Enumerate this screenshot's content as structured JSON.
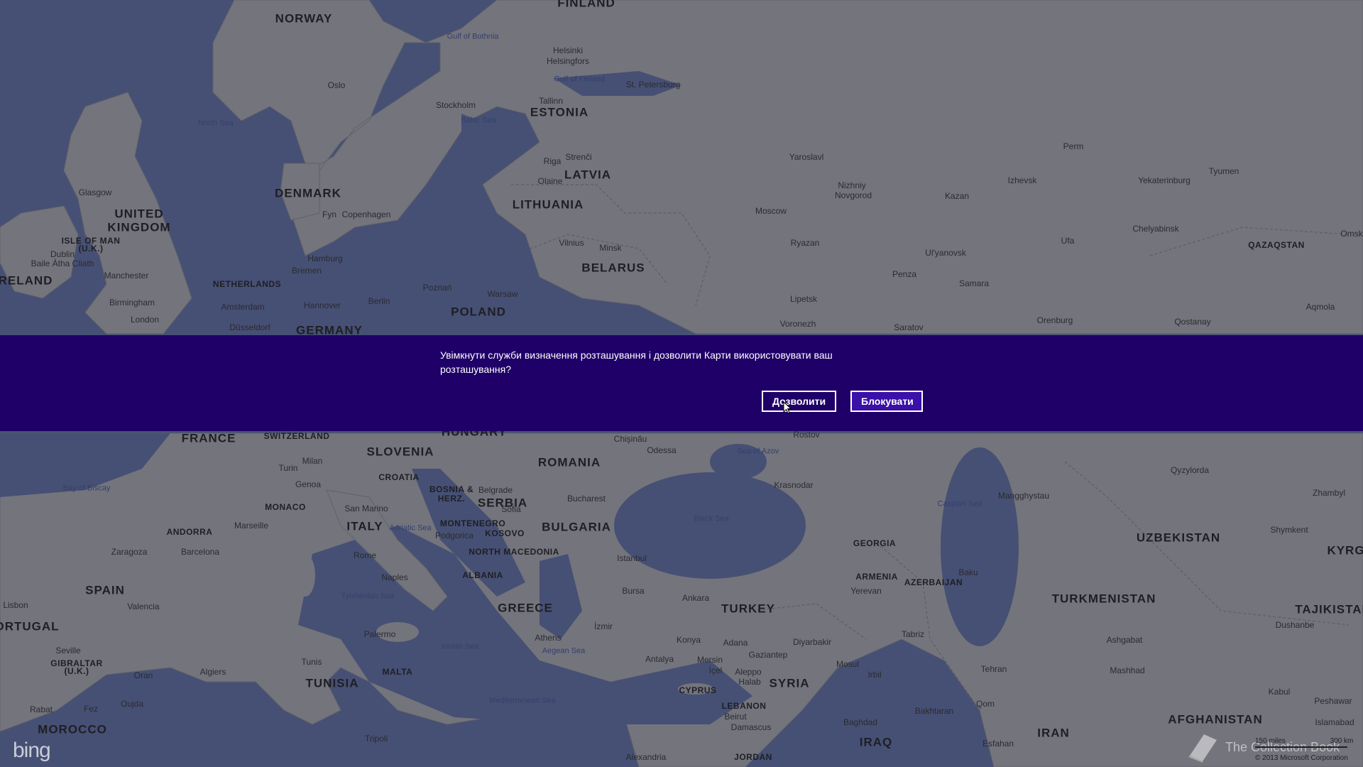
{
  "map": {
    "countries": [
      "NORWAY",
      "FINLAND",
      "ESTONIA",
      "LATVIA",
      "LITHUANIA",
      "BELARUS",
      "DENMARK",
      "UNITED",
      "KINGDOM",
      "POLAND",
      "GERMANY",
      "NETHERLANDS",
      "RELAND",
      "FRANCE",
      "SWITZERLAND",
      "SLOVENIA",
      "CROATIA",
      "HUNGARY",
      "ROMANIA",
      "SERBIA",
      "BULGARIA",
      "ITALY",
      "SPAIN",
      "ORTUGAL",
      "GREECE",
      "ALBANIA",
      "TURKEY",
      "SYRIA",
      "IRAQ",
      "IRAN",
      "TUNISIA",
      "MOROCCO",
      "MALTA",
      "UZBEKISTAN",
      "TURKMENISTAN",
      "AFGHANISTAN",
      "TAJIKISTAN",
      "GEORGIA",
      "AZERBAIJAN",
      "ARMENIA",
      "KYRG",
      "CYPRUS",
      "LEBANON",
      "JORDAN",
      "MONACO",
      "ANDORRA",
      "KOSOVO",
      "MONTENEGRO",
      "NORTH MACEDONIA",
      "BOSNIA &",
      "HERZ.",
      "ISLE OF MAN",
      "(U.K.)",
      "GIBRALTAR",
      "(U.K.)",
      "QAZAQSTAN"
    ],
    "cities": [
      "Oslo",
      "Stockholm",
      "Helsinki",
      "Helsingfors",
      "Tallinn",
      "St. Petersburg",
      "Riga",
      "Strenči",
      "Olaine",
      "Vilnius",
      "Minsk",
      "Copenhagen",
      "Fyn",
      "Hamburg",
      "Bremen",
      "Amsterdam",
      "Hannover",
      "Berlin",
      "Poznań",
      "Warsaw",
      "Düsseldorf",
      "Glasgow",
      "Dublin",
      "Baile Átha Cliath",
      "Manchester",
      "Birmingham",
      "London",
      "Moscow",
      "Yaroslavl",
      "Nizhniy",
      "Novgorod",
      "Kazan",
      "Ryazan",
      "Izhevsk",
      "Perm",
      "Yekaterinburg",
      "Tyumen",
      "Chelyabinsk",
      "Ufa",
      "Ul'yanovsk",
      "Samara",
      "Penza",
      "Lipetsk",
      "Voronezh",
      "Saratov",
      "Orenburg",
      "Omsk",
      "Aqmola",
      "Qostanay",
      "Milan",
      "Turin",
      "Genoa",
      "San Marino",
      "Marseille",
      "Barcelona",
      "Zaragoza",
      "Valencia",
      "Lisbon",
      "Seville",
      "Rome",
      "Naples",
      "Palermo",
      "Algiers",
      "Tunis",
      "Rabat",
      "Fez",
      "Oujda",
      "Oran",
      "Tripoli",
      "Belgrade",
      "Bucharest",
      "Sofia",
      "Podgorica",
      "Istanbul",
      "Bursa",
      "Ankara",
      "İzmir",
      "Konya",
      "Antalya",
      "Adana",
      "Mersin",
      "İçel",
      "Gaziantep",
      "Aleppo",
      "Halab",
      "Damascus",
      "Beirut",
      "Athens",
      "Odessa",
      "Chişinău",
      "Rostov",
      "Krasnodar",
      "Yerevan",
      "Baku",
      "Tabriz",
      "Mosul",
      "Irbil",
      "Diyarbakir",
      "Baghdad",
      "Bakhtaran",
      "Qom",
      "Tehran",
      "Esfahan",
      "Ashgabat",
      "Mashhad",
      "Kabul",
      "Peshawar",
      "Islamabad",
      "Shymkent",
      "Dushanbe",
      "Alexandria",
      "Qyzylorda",
      "Zhambyl",
      "Mangghystau"
    ],
    "seas": [
      "Gulf of Bothnia",
      "Gulf of Finland",
      "Baltic Sea",
      "North Sea",
      "Bay of Biscay",
      "Adriatic Sea",
      "Tyrrhenian Sea",
      "Ionian Sea",
      "Aegean Sea",
      "Mediterranean Sea",
      "Black Sea",
      "Sea of Azov",
      "Caspian Sea"
    ]
  },
  "banner": {
    "message": "Увімкнути служби визначення розташування і дозволити Карти використовувати ваш розташування?",
    "allow_label": "Дозволити",
    "block_label": "Блокувати"
  },
  "footer": {
    "bing_logo": "bing",
    "scale_miles": "150 miles",
    "scale_km": "300 km",
    "copyright": "© 2013 Microsoft Corporation",
    "watermark": "The Collection Book"
  },
  "colors": {
    "banner": "#1f0068",
    "block_button": "#3a10a8",
    "sea": "#4d5a80",
    "land": "#86868a"
  }
}
